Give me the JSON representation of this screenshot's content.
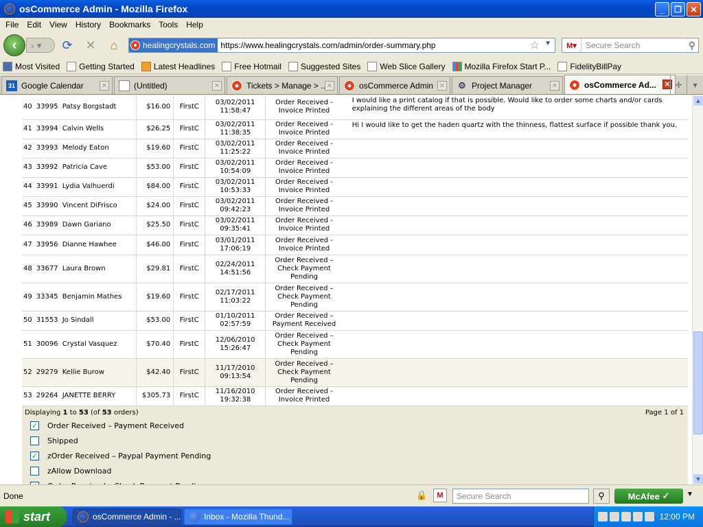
{
  "window": {
    "title": "osCommerce Admin - Mozilla Firefox"
  },
  "menu": [
    "File",
    "Edit",
    "View",
    "History",
    "Bookmarks",
    "Tools",
    "Help"
  ],
  "nav": {
    "site_identity": "healingcrystals.com",
    "url": "https://www.healingcrystals.com/admin/order-summary.php",
    "search_placeholder": "Secure Search"
  },
  "bookmarks": [
    "Most Visited",
    "Getting Started",
    "Latest Headlines",
    "Free Hotmail",
    "Suggested Sites",
    "Web Slice Gallery",
    "Mozilla Firefox Start P...",
    "FidelityBillPay"
  ],
  "tabs": [
    {
      "label": "Google Calendar",
      "icon": "calendar-icon",
      "icon_text": "31"
    },
    {
      "label": "(Untitled)",
      "icon": "document-icon"
    },
    {
      "label": "Tickets > Manage > ...",
      "icon": "oscommerce-icon"
    },
    {
      "label": "osCommerce Admin",
      "icon": "oscommerce-icon"
    },
    {
      "label": "Project Manager",
      "icon": "project-icon"
    },
    {
      "label": "osCommerce Ad...",
      "icon": "oscommerce-icon"
    }
  ],
  "orders": [
    {
      "num": "40",
      "id": "33995",
      "name": "Patsy Borgstadt",
      "total": "$16.00",
      "ship": "FirstC",
      "date": "03/02/2011",
      "time": "11:58:47",
      "status": [
        "Order Received -",
        "Invoice Printed"
      ],
      "comment": "I would like a print catalog if that is possible. Would like to order some charts and/or cards explaining the different areas of the body"
    },
    {
      "num": "41",
      "id": "33994",
      "name": "Calvin Wells",
      "total": "$26.25",
      "ship": "FirstC",
      "date": "03/02/2011",
      "time": "11:38:35",
      "status": [
        "Order Received -",
        "Invoice Printed"
      ],
      "comment": "Hi I would like to get the haden quartz with the thinness, flattest surface if possible thank you."
    },
    {
      "num": "42",
      "id": "33993",
      "name": "Melody Eaton",
      "total": "$19.60",
      "ship": "FirstC",
      "date": "03/02/2011",
      "time": "11:25:22",
      "status": [
        "Order Received -",
        "Invoice Printed"
      ],
      "comment": ""
    },
    {
      "num": "43",
      "id": "33992",
      "name": "Patricia Cave",
      "total": "$53.00",
      "ship": "FirstC",
      "date": "03/02/2011",
      "time": "10:54:09",
      "status": [
        "Order Received -",
        "Invoice Printed"
      ],
      "comment": ""
    },
    {
      "num": "44",
      "id": "33991",
      "name": "Lydia Valhuerdi",
      "total": "$84.00",
      "ship": "FirstC",
      "date": "03/02/2011",
      "time": "10:53:33",
      "status": [
        "Order Received -",
        "Invoice Printed"
      ],
      "comment": ""
    },
    {
      "num": "45",
      "id": "33990",
      "name": "Vincent DiFrisco",
      "total": "$24.00",
      "ship": "FirstC",
      "date": "03/02/2011",
      "time": "09:42:23",
      "status": [
        "Order Received -",
        "Invoice Printed"
      ],
      "comment": ""
    },
    {
      "num": "46",
      "id": "33989",
      "name": "Dawn Gariano",
      "total": "$25.50",
      "ship": "FirstC",
      "date": "03/02/2011",
      "time": "09:35:41",
      "status": [
        "Order Received -",
        "Invoice Printed"
      ],
      "comment": ""
    },
    {
      "num": "47",
      "id": "33956",
      "name": "Dianne Hawhee",
      "total": "$46.00",
      "ship": "FirstC",
      "date": "03/01/2011",
      "time": "17:06:19",
      "status": [
        "Order Received -",
        "Invoice Printed"
      ],
      "comment": ""
    },
    {
      "num": "48",
      "id": "33677",
      "name": "Laura Brown",
      "total": "$29.81",
      "ship": "FirstC",
      "date": "02/24/2011",
      "time": "14:51:56",
      "status": [
        "Order Received –",
        "Check Payment",
        "Pending"
      ],
      "comment": ""
    },
    {
      "num": "49",
      "id": "33345",
      "name": "Benjamin Mathes",
      "total": "$19.60",
      "ship": "FirstC",
      "date": "02/17/2011",
      "time": "11:03:22",
      "status": [
        "Order Received –",
        "Check Payment",
        "Pending"
      ],
      "comment": ""
    },
    {
      "num": "50",
      "id": "31553",
      "name": "Jo Sindall",
      "total": "$53.00",
      "ship": "FirstC",
      "date": "01/10/2011",
      "time": "02:57:59",
      "status": [
        "Order Received –",
        "Payment Received"
      ],
      "comment": ""
    },
    {
      "num": "51",
      "id": "30096",
      "name": "Crystal Vasquez",
      "total": "$70.40",
      "ship": "FirstC",
      "date": "12/06/2010",
      "time": "15:26:47",
      "status": [
        "Order Received –",
        "Check Payment",
        "Pending"
      ],
      "comment": ""
    },
    {
      "num": "52",
      "id": "29279",
      "name": "Kellie Burow",
      "total": "$42.40",
      "ship": "FirstC",
      "date": "11/17/2010",
      "time": "09:13:54",
      "status": [
        "Order Received –",
        "Check Payment",
        "Pending"
      ],
      "comment": ""
    },
    {
      "num": "53",
      "id": "29264",
      "name": "JANETTE BERRY",
      "total": "$305.73",
      "ship": "FirstC",
      "date": "11/16/2010",
      "time": "19:32:38",
      "status": [
        "Order Received -",
        "Invoice Printed"
      ],
      "comment": ""
    }
  ],
  "footer": {
    "displaying_prefix": "Displaying ",
    "from": "1",
    "to_word": " to ",
    "to": "53",
    "of_prefix": " (of ",
    "total": "53",
    "of_suffix": " orders)",
    "page": "Page 1 of 1"
  },
  "status_filters": [
    {
      "label": "Order Received – Payment Received",
      "checked": true
    },
    {
      "label": "Shipped",
      "checked": false
    },
    {
      "label": "zOrder Received – Paypal Payment Pending",
      "checked": true
    },
    {
      "label": "zAllow Download",
      "checked": false
    },
    {
      "label": "Order Received – Check Payment Pending",
      "checked": true
    }
  ],
  "statusbar": {
    "text": "Done",
    "search_placeholder": "Secure Search",
    "mcafee": "McAfee"
  },
  "taskbar": {
    "start": "start",
    "tasks": [
      "osCommerce Admin - ...",
      "Inbox - Mozilla Thund..."
    ],
    "clock": "12:00 PM"
  }
}
